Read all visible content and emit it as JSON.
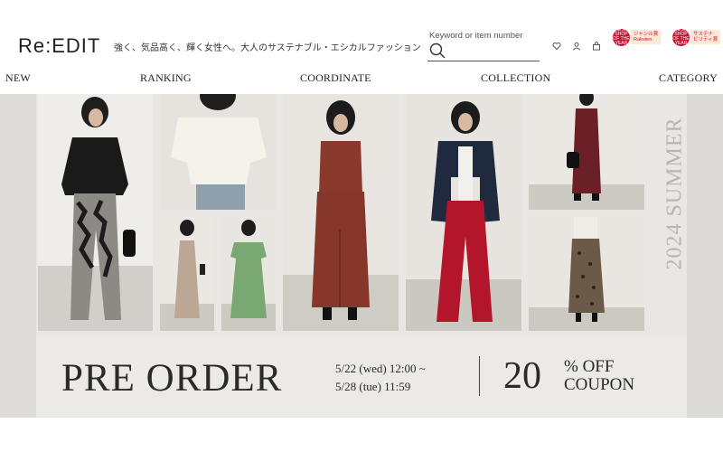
{
  "header": {
    "logo": "Re:EDIT",
    "tagline": "強く、気品高く、輝く女性へ。大人のサステナブル・エシカルファッション",
    "search_placeholder": "Keyword or item number",
    "icons": [
      "heart-icon",
      "user-icon",
      "cart-icon"
    ],
    "badges": [
      {
        "medal": "楽天SHOP OF THE YEAR",
        "line1": "ジャンル賞",
        "line2": "Rakuten"
      },
      {
        "medal": "楽天SHOP OF THE YEAR",
        "line1": "サステナ",
        "line2": "ビリティ賞"
      }
    ]
  },
  "nav": {
    "items": [
      "NEW",
      "RANKING",
      "COORDINATE",
      "COLLECTION",
      "CATEGORY"
    ]
  },
  "hero": {
    "season": "2024 SUMMER",
    "title": "PRE ORDER",
    "date_line1": "5/22 (wed) 12:00 ~",
    "date_line2": "5/28 (tue) 11:59",
    "discount": "20",
    "discount_unit": "% OFF",
    "discount_label": "COUPON"
  },
  "colors": {
    "hero_bg": "#e9e7e4",
    "brown_dress": "#8a3a2c",
    "red_pants": "#b3162a",
    "green_dress": "#7aa872",
    "text": "#2a2a2a"
  }
}
